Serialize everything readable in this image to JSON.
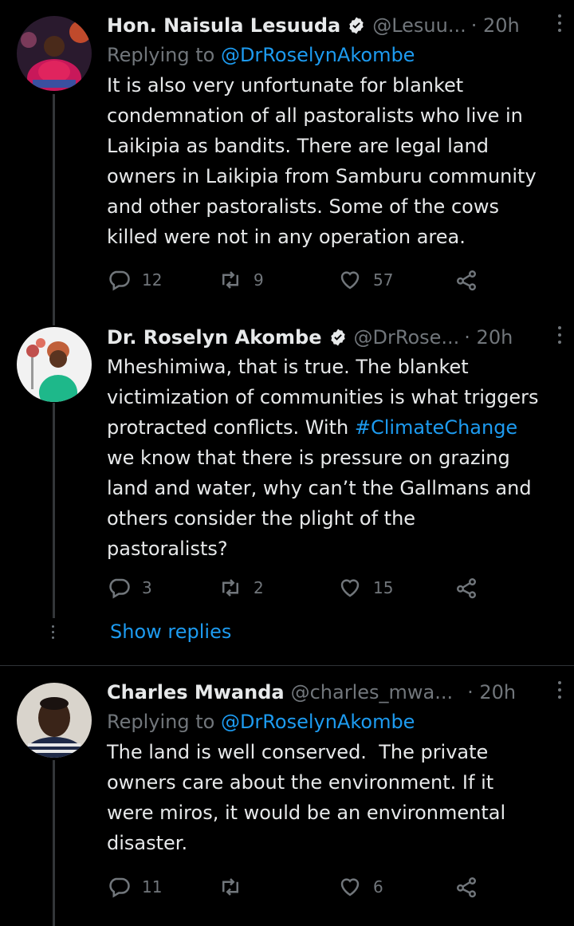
{
  "tweets": [
    {
      "name": "Hon. Naisula Lesuuda",
      "handle": "@Lesuu...",
      "time": "· 20h",
      "replying_prefix": "Replying to ",
      "replying_to": "@DrRoselynAkombe",
      "text": "It is also very unfortunate for blanket\ncondemnation of all pastoralists who live in\nLaikipia as bandits. There are legal land\nowners in Laikipia from Samburu community\nand other pastoralists. Some of the cows\nkilled were not in any operation area.",
      "replies": "12",
      "retweets": "9",
      "likes": "57"
    },
    {
      "name": "Dr. Roselyn Akombe",
      "handle": "@DrRose...",
      "time": "· 20h",
      "text_before": "Mheshimiwa, that is true. The blanket\nvictimization of communities is what triggers\nprotracted conflicts. With ",
      "hashtag": "#ClimateChange",
      "text_after": "\nwe know that there is pressure on grazing\nland and water, why can’t the Gallmans and\nothers consider the plight of the\npastoralists?",
      "replies": "3",
      "retweets": "2",
      "likes": "15"
    },
    {
      "name": "Charles Mwanda",
      "handle": "@charles_mwa...",
      "time": "· 20h",
      "replying_prefix": "Replying to ",
      "replying_to": "@DrRoselynAkombe",
      "text": "The land is well conserved.  The private\nowners care about the environment. If it\nwere miros, it would be an environmental\ndisaster.",
      "replies": "11",
      "retweets": "",
      "likes": "6"
    }
  ],
  "show_replies_label": "Show replies",
  "colors": {
    "accent": "#1d9bf0",
    "muted": "#71767b",
    "text": "#e7e9ea",
    "background": "#000000"
  }
}
